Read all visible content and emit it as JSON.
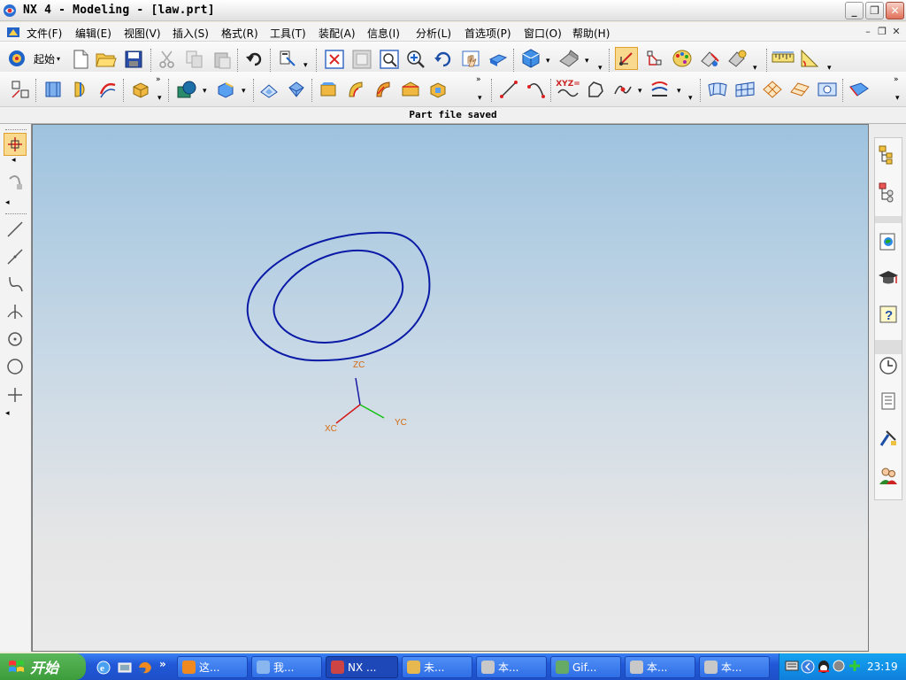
{
  "window": {
    "title": "NX 4 - Modeling - [law.prt]",
    "controls": [
      "minimize",
      "restore",
      "close"
    ]
  },
  "menubar": {
    "items": [
      {
        "label": "文件(F)"
      },
      {
        "label": "编辑(E)"
      },
      {
        "label": "视图(V)"
      },
      {
        "label": "插入(S)"
      },
      {
        "label": "格式(R)"
      },
      {
        "label": "工具(T)"
      },
      {
        "label": "装配(A)"
      },
      {
        "label": "信息(I)"
      },
      {
        "label": "分析(L)"
      },
      {
        "label": "首选项(P)"
      },
      {
        "label": "窗口(O)"
      },
      {
        "label": "帮助(H)"
      }
    ]
  },
  "toolbar1": {
    "start_label": "起始",
    "icons": [
      "new-file-icon",
      "open-file-icon",
      "save-icon",
      "cut-icon",
      "copy-icon",
      "paste-icon",
      "undo-icon",
      "selection-filter-icon",
      "fit-view-icon",
      "zoom-window-icon",
      "zoom-region-icon",
      "zoom-in-out-icon",
      "rotate-icon",
      "pan-icon",
      "perspective-icon",
      "shaded-view-icon",
      "render-style-icon",
      "wcs-icon",
      "wcs-orient-icon",
      "color-palette-icon",
      "edit-object-icon",
      "object-display-icon",
      "measure-distance-icon",
      "measure-angle-icon"
    ]
  },
  "toolbar2": {
    "icons": [
      "sketch-icon",
      "extrude-icon",
      "revolve-icon",
      "sweep-icon",
      "block-icon",
      "boolean-icon",
      "edge-blend-icon",
      "hollow-icon",
      "draft-icon",
      "surface-1-icon",
      "surface-2-icon",
      "surface-3-icon",
      "surface-4-icon",
      "surface-5-icon",
      "line-icon",
      "arc-icon",
      "law-curve-icon",
      "spline-icon",
      "point-icon",
      "basic-curve-icon",
      "through-curves-icon",
      "ruled-icon",
      "mesh-icon",
      "offset-surface-icon",
      "trim-icon",
      "feature-icon"
    ],
    "law_label": "XYZ="
  },
  "statusbar": {
    "message": "Part file saved"
  },
  "viewport": {
    "axes": {
      "x_label": "XC",
      "y_label": "YC",
      "z_label": "ZC"
    },
    "curve_color": "#0a1aa6"
  },
  "leftbar": {
    "icons": [
      "select-icon",
      "snap-icon",
      "line-tool-icon",
      "line-2-icon",
      "curve-tool-icon",
      "point-on-curve-icon",
      "circle-center-icon",
      "circle-icon",
      "crosshair-icon"
    ]
  },
  "resource_bar": {
    "icons": [
      "assembly-navigator-icon",
      "part-navigator-icon",
      "web-browser-icon",
      "training-icon",
      "help-icon",
      "history-icon",
      "system-materials-icon",
      "process-studio-icon",
      "roles-icon"
    ]
  },
  "taskbar": {
    "start_label": "开始",
    "quicklaunch": [
      "ie-icon",
      "desktop-icon",
      "firefox-icon"
    ],
    "tasks": [
      {
        "label": "这..."
      },
      {
        "label": "我..."
      },
      {
        "label": "NX ..."
      },
      {
        "label": "未..."
      },
      {
        "label": "本..."
      },
      {
        "label": "Gif..."
      },
      {
        "label": "本..."
      },
      {
        "label": "本..."
      }
    ],
    "clock": "23:19"
  }
}
